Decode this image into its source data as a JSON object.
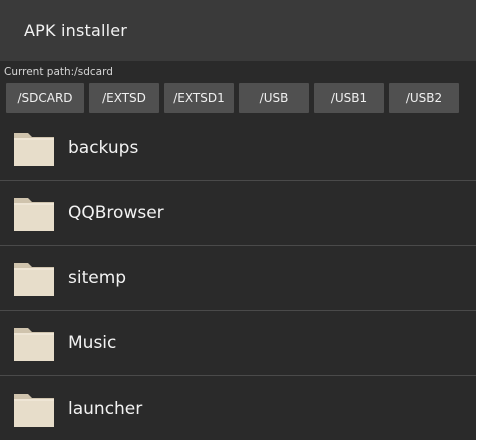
{
  "app": {
    "title": "APK installer"
  },
  "path": {
    "text": "Current path:/sdcard"
  },
  "tabs": [
    {
      "label": "/SDCARD"
    },
    {
      "label": "/EXTSD"
    },
    {
      "label": "/EXTSD1"
    },
    {
      "label": "/USB"
    },
    {
      "label": "/USB1"
    },
    {
      "label": "/USB2"
    }
  ],
  "folders": [
    {
      "name": "backups",
      "icon": "folder-icon"
    },
    {
      "name": "QQBrowser",
      "icon": "folder-icon"
    },
    {
      "name": "sitemp",
      "icon": "folder-icon"
    },
    {
      "name": "Music",
      "icon": "folder-icon"
    },
    {
      "name": "launcher",
      "icon": "folder-icon"
    }
  ],
  "colors": {
    "background": "#2a2a2a",
    "titlebar": "#3a3a3a",
    "tab": "#505050",
    "folder": "#e6dcc9",
    "text": "#f2f2f2"
  }
}
